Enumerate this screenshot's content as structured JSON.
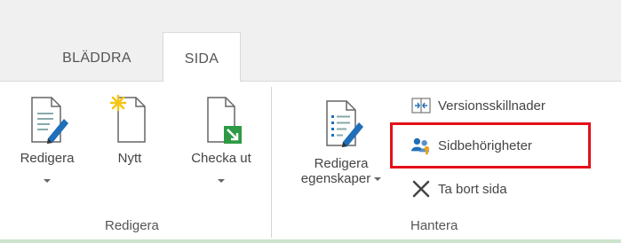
{
  "tabs": [
    {
      "label": "BLÄDDRA",
      "selected": false
    },
    {
      "label": "SIDA",
      "selected": true
    }
  ],
  "groups": {
    "edit": {
      "label": "Redigera",
      "buttons": {
        "edit": {
          "label": "Redigera",
          "icon": "edit-page-icon"
        },
        "new": {
          "label": "Nytt",
          "icon": "new-page-icon"
        },
        "checkout": {
          "label": "Checka ut",
          "icon": "check-out-icon"
        }
      }
    },
    "manage": {
      "label": "Hantera",
      "edit_properties": {
        "label_line1": "Redigera",
        "label_line2": "egenskaper",
        "icon": "edit-properties-icon"
      },
      "version_diff": {
        "label": "Versionsskillnader",
        "icon": "version-compare-icon"
      },
      "page_permissions": {
        "label": "Sidbehörigheter",
        "icon": "permissions-icon",
        "highlighted": true
      },
      "delete_page": {
        "label": "Ta bort sida",
        "icon": "delete-icon"
      }
    }
  },
  "colors": {
    "highlight": "#e3101a",
    "icon_blue": "#1f6fb8",
    "icon_green": "#2e9a45",
    "new_star": "#f5c518"
  }
}
